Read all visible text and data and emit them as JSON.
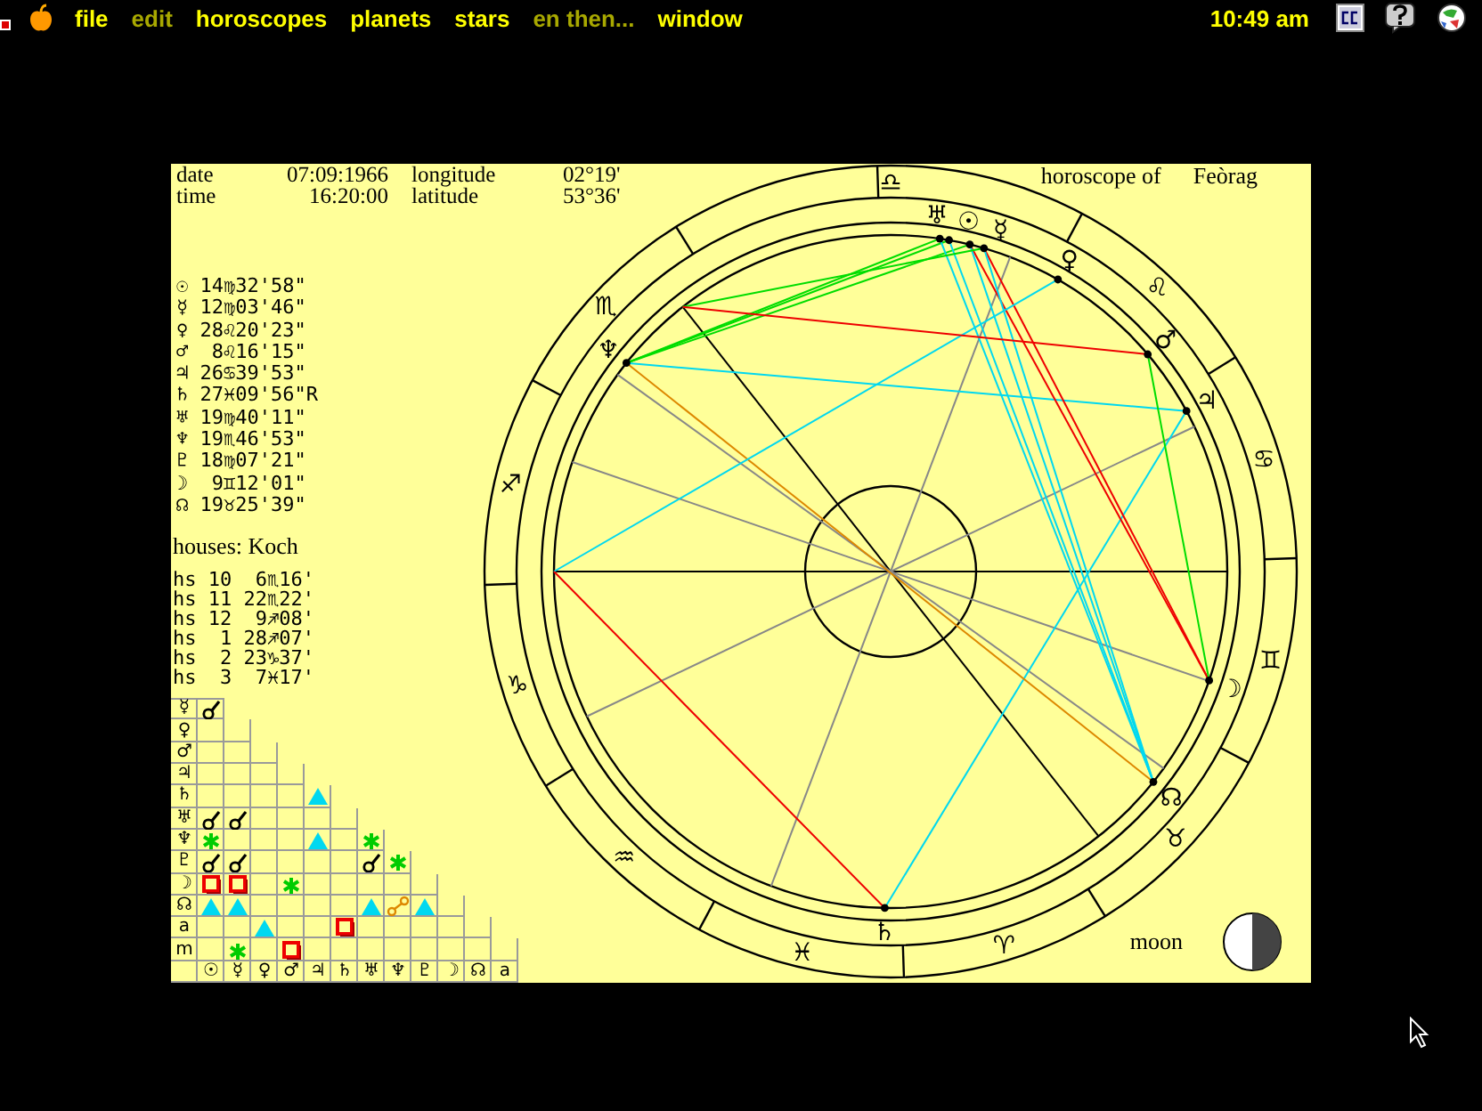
{
  "menu_bar": {
    "items": [
      {
        "label": "file",
        "disabled": false
      },
      {
        "label": "edit",
        "disabled": true
      },
      {
        "label": "horoscopes",
        "disabled": false
      },
      {
        "label": "planets",
        "disabled": false
      },
      {
        "label": "stars",
        "disabled": false
      },
      {
        "label": "en then...",
        "disabled": true
      },
      {
        "label": "window",
        "disabled": false
      }
    ],
    "clock": "10:49 am"
  },
  "chart": {
    "fields": [
      {
        "label": "date",
        "value": "07:09:1966"
      },
      {
        "label": "longitude",
        "value": "02°19'"
      },
      {
        "label": "time",
        "value": "16:20:00"
      },
      {
        "label": "latitude",
        "value": "53°36'"
      }
    ],
    "title": "horoscope of",
    "name": "Feòrag",
    "planet_positions": [
      "☉ 14♍32'58\"",
      "☿ 12♍03'46\"",
      "♀ 28♌20'23\"",
      "♂  8♌16'15\"",
      "♃ 26♋39'53\"",
      "♄ 27♓09'56\"R",
      "♅ 19♍40'11\"",
      "♆ 19♏46'53\"",
      "♇ 18♍07'21\"",
      "☽  9♊12'01\"",
      "☊ 19♉25'39\""
    ],
    "houses": {
      "title": "houses: Koch",
      "cusps": [
        "hs 10  6♏16'",
        "hs 11 22♏22'",
        "hs 12  9♐08'",
        "hs  1 28♐07'",
        "hs  2 23♑37'",
        "hs  3  7♓17'"
      ]
    },
    "aspect_grid": {
      "rows": [
        {
          "label": "☿",
          "cells": [
            {
              "kind": "conjunction"
            }
          ]
        },
        {
          "label": "♀",
          "cells": [
            {
              "kind": "none"
            },
            {
              "kind": "none"
            }
          ]
        },
        {
          "label": "♂",
          "cells": [
            {
              "kind": "none"
            },
            {
              "kind": "none"
            },
            {
              "kind": "none"
            }
          ]
        },
        {
          "label": "♃",
          "cells": [
            {
              "kind": "none"
            },
            {
              "kind": "none"
            },
            {
              "kind": "none"
            },
            {
              "kind": "none"
            }
          ]
        },
        {
          "label": "♄",
          "cells": [
            {
              "kind": "none"
            },
            {
              "kind": "none"
            },
            {
              "kind": "none"
            },
            {
              "kind": "none"
            },
            {
              "kind": "trine"
            }
          ]
        },
        {
          "label": "♅",
          "cells": [
            {
              "kind": "conjunction"
            },
            {
              "kind": "conjunction"
            },
            {
              "kind": "none"
            },
            {
              "kind": "none"
            },
            {
              "kind": "none"
            },
            {
              "kind": "none"
            }
          ]
        },
        {
          "label": "♆",
          "cells": [
            {
              "kind": "sextile"
            },
            {
              "kind": "none"
            },
            {
              "kind": "none"
            },
            {
              "kind": "none"
            },
            {
              "kind": "trine"
            },
            {
              "kind": "none"
            },
            {
              "kind": "sextile"
            }
          ]
        },
        {
          "label": "♇",
          "cells": [
            {
              "kind": "conjunction"
            },
            {
              "kind": "conjunction"
            },
            {
              "kind": "none"
            },
            {
              "kind": "none"
            },
            {
              "kind": "none"
            },
            {
              "kind": "none"
            },
            {
              "kind": "conjunction"
            },
            {
              "kind": "sextile"
            }
          ]
        },
        {
          "label": "☽",
          "cells": [
            {
              "kind": "square"
            },
            {
              "kind": "square"
            },
            {
              "kind": "none"
            },
            {
              "kind": "sextile"
            },
            {
              "kind": "none"
            },
            {
              "kind": "none"
            },
            {
              "kind": "none"
            },
            {
              "kind": "none"
            },
            {
              "kind": "none"
            }
          ]
        },
        {
          "label": "☊",
          "cells": [
            {
              "kind": "trine"
            },
            {
              "kind": "trine"
            },
            {
              "kind": "none"
            },
            {
              "kind": "none"
            },
            {
              "kind": "none"
            },
            {
              "kind": "none"
            },
            {
              "kind": "trine"
            },
            {
              "kind": "opposition"
            },
            {
              "kind": "trine"
            },
            {
              "kind": "none"
            }
          ]
        },
        {
          "label": "a",
          "cells": [
            {
              "kind": "none"
            },
            {
              "kind": "none"
            },
            {
              "kind": "trine"
            },
            {
              "kind": "none"
            },
            {
              "kind": "none"
            },
            {
              "kind": "square"
            },
            {
              "kind": "none"
            },
            {
              "kind": "none"
            },
            {
              "kind": "none"
            },
            {
              "kind": "none"
            },
            {
              "kind": "none"
            }
          ]
        },
        {
          "label": "m",
          "cells": [
            {
              "kind": "none"
            },
            {
              "kind": "sextile"
            },
            {
              "kind": "none"
            },
            {
              "kind": "square"
            },
            {
              "kind": "none"
            },
            {
              "kind": "none"
            },
            {
              "kind": "none"
            },
            {
              "kind": "none"
            },
            {
              "kind": "none"
            },
            {
              "kind": "none"
            },
            {
              "kind": "none"
            },
            {
              "kind": "none"
            }
          ]
        }
      ],
      "column_labels": [
        "☉",
        "☿",
        "♀",
        "♂",
        "♃",
        "♄",
        "♅",
        "♆",
        "♇",
        "☽",
        "☊",
        "a"
      ]
    },
    "wheel": {
      "signs": [
        "♋",
        "♌",
        "♎",
        "♏",
        "♐",
        "♑",
        "♒",
        "♓",
        "♈",
        "♉",
        "♊"
      ],
      "planets": [
        "☉",
        "☿",
        "♀",
        "♂",
        "♃",
        "♄",
        "♅",
        "♆",
        "☽",
        "☊"
      ]
    },
    "moon_phase": {
      "label": "moon"
    }
  }
}
